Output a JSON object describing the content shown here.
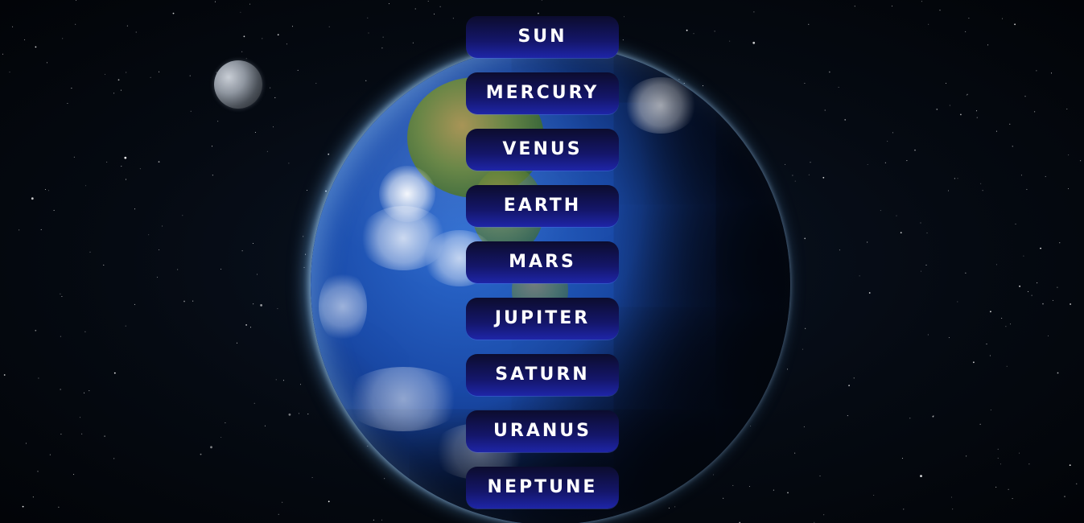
{
  "menu": {
    "items": [
      {
        "label": "SUN"
      },
      {
        "label": "MERCURY"
      },
      {
        "label": "VENUS"
      },
      {
        "label": "EARTH"
      },
      {
        "label": "MARS"
      },
      {
        "label": "JUPITER"
      },
      {
        "label": "SATURN"
      },
      {
        "label": "URANUS"
      },
      {
        "label": "NEPTUNE"
      }
    ]
  },
  "colors": {
    "background": "#03070d",
    "button_top": "#0c0c2e",
    "button_bottom": "#1e25a8",
    "button_text": "#ffffff",
    "ocean": "#1a4aa8"
  }
}
